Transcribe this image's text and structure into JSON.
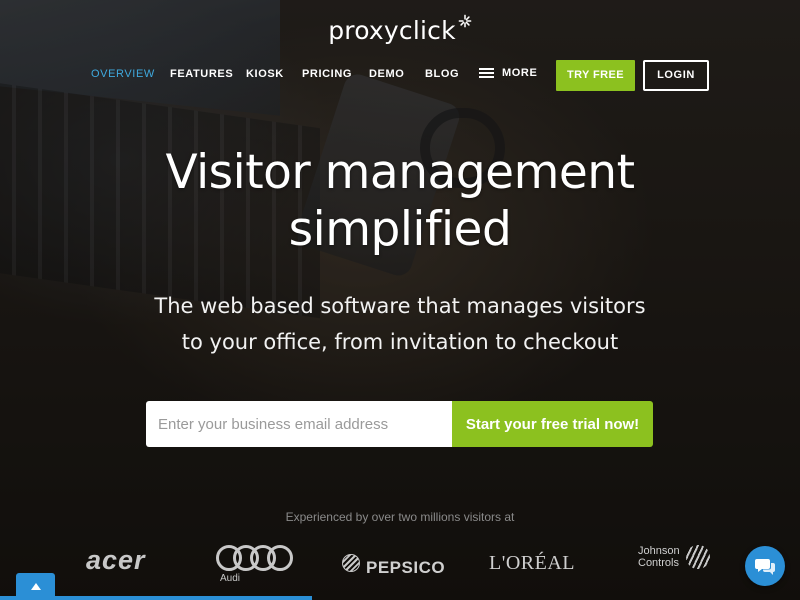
{
  "brand": {
    "name": "proxyclick"
  },
  "nav": {
    "items": [
      {
        "label": "OVERVIEW",
        "active": true
      },
      {
        "label": "FEATURES",
        "active": false
      },
      {
        "label": "KIOSK",
        "active": false
      },
      {
        "label": "PRICING",
        "active": false
      },
      {
        "label": "DEMO",
        "active": false
      },
      {
        "label": "BLOG",
        "active": false
      }
    ],
    "more_label": "MORE",
    "try_free_label": "TRY FREE",
    "login_label": "LOGIN"
  },
  "hero": {
    "headline_line1": "Visitor management",
    "headline_line2": "simplified",
    "subhead_line1": "The web based software that manages visitors",
    "subhead_line2": "to your office, from invitation to checkout"
  },
  "signup": {
    "placeholder": "Enter your business email address",
    "value": "",
    "cta_label": "Start your free trial now!"
  },
  "clients": {
    "caption": "Experienced by over two millions visitors at",
    "logos": [
      "acer",
      "Audi",
      "PEPSICO",
      "L'ORÉAL",
      "Johnson Controls"
    ],
    "acer_text": "acer",
    "audi_text": "Audi",
    "pepsico_text": "PEPSICO",
    "loreal_text": "L'ORÉAL",
    "johnson_line1": "Johnson",
    "johnson_line2": "Controls"
  },
  "widgets": {
    "chat_icon": "chat-bubbles-icon",
    "scroll_top_icon": "arrow-up-icon"
  },
  "colors": {
    "accent_green": "#8cc11f",
    "accent_blue": "#3fa9de",
    "widget_blue": "#2b8fd6"
  }
}
